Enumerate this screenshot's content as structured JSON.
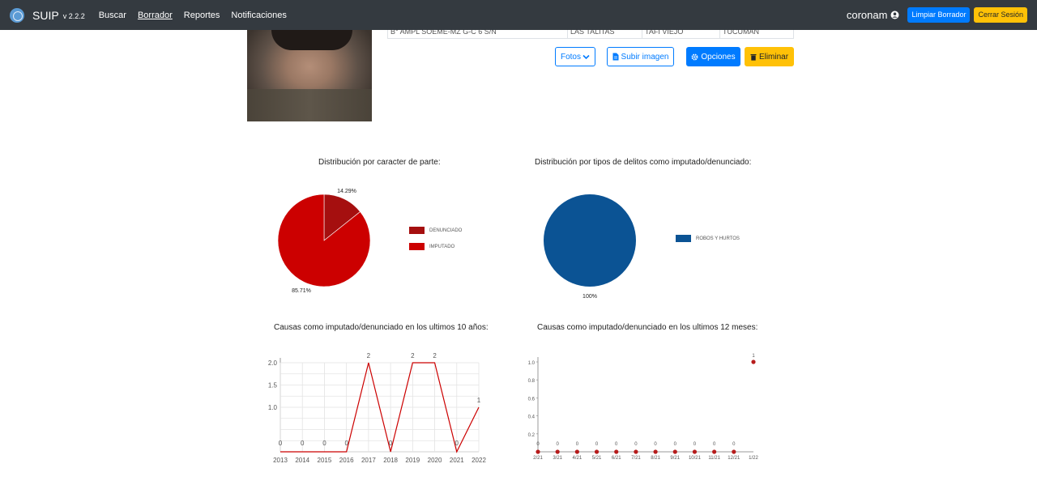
{
  "navbar": {
    "brand": "SUIP",
    "version": "v 2.2.2",
    "links": [
      "Buscar",
      "Borrador",
      "Reportes",
      "Notificaciones"
    ],
    "user": "coronam",
    "clear_draft_label": "Limpiar Borrador",
    "logout_label": "Cerrar Sesión"
  },
  "address_row": [
    "B° AMPL SOEME-MZ G-C 6 S/N",
    "LAS TALITAS",
    "TAFI VIEJO",
    "TUCUMAN"
  ],
  "actions": {
    "fotos": "Fotos",
    "subir_imagen": "Subir imagen",
    "opciones": "Opciones",
    "eliminar": "Eliminar"
  },
  "colors": {
    "navbar": "#343a40",
    "primary": "#007bff",
    "warning": "#ffc107",
    "denunciado": "#a50f0f",
    "imputado": "#cc0000",
    "robos": "#0b5394",
    "line": "#cc0000"
  },
  "chart_data": [
    {
      "type": "pie",
      "title": "Distribución por caracter de parte:",
      "labels": [
        "DENUNCIADO",
        "IMPUTADO"
      ],
      "values": [
        14.29,
        85.71
      ],
      "value_labels": [
        "14.29%",
        "85.71%"
      ],
      "legend": "right"
    },
    {
      "type": "pie",
      "title": "Distribución por tipos de delitos como imputado/denunciado:",
      "labels": [
        "ROBOS Y HURTOS"
      ],
      "values": [
        100
      ],
      "value_labels": [
        "100%"
      ],
      "legend": "right"
    },
    {
      "type": "line",
      "title": "Causas como imputado/denunciado en los ultimos 10 años:",
      "x": [
        "2013",
        "2014",
        "2015",
        "2016",
        "2017",
        "2018",
        "2019",
        "2020",
        "2021",
        "2022"
      ],
      "values": [
        0,
        0,
        0,
        0,
        2,
        0,
        2,
        2,
        0,
        1
      ],
      "yticks": [
        "1.0",
        "1.5",
        "2.0"
      ],
      "ylim": [
        0,
        2
      ],
      "grid": true
    },
    {
      "type": "line",
      "title": "Causas como imputado/denunciado en los ultimos 12 meses:",
      "x": [
        "2/21",
        "3/21",
        "4/21",
        "5/21",
        "6/21",
        "7/21",
        "8/21",
        "9/21",
        "10/21",
        "11/21",
        "12/21",
        "1/22"
      ],
      "values": [
        0,
        0,
        0,
        0,
        0,
        0,
        0,
        0,
        0,
        0,
        0,
        1
      ],
      "yticks": [
        "0.2",
        "0.4",
        "0.6",
        "0.8",
        "1.0"
      ],
      "ylim": [
        0,
        1
      ],
      "grid": false,
      "show_line": false
    }
  ]
}
